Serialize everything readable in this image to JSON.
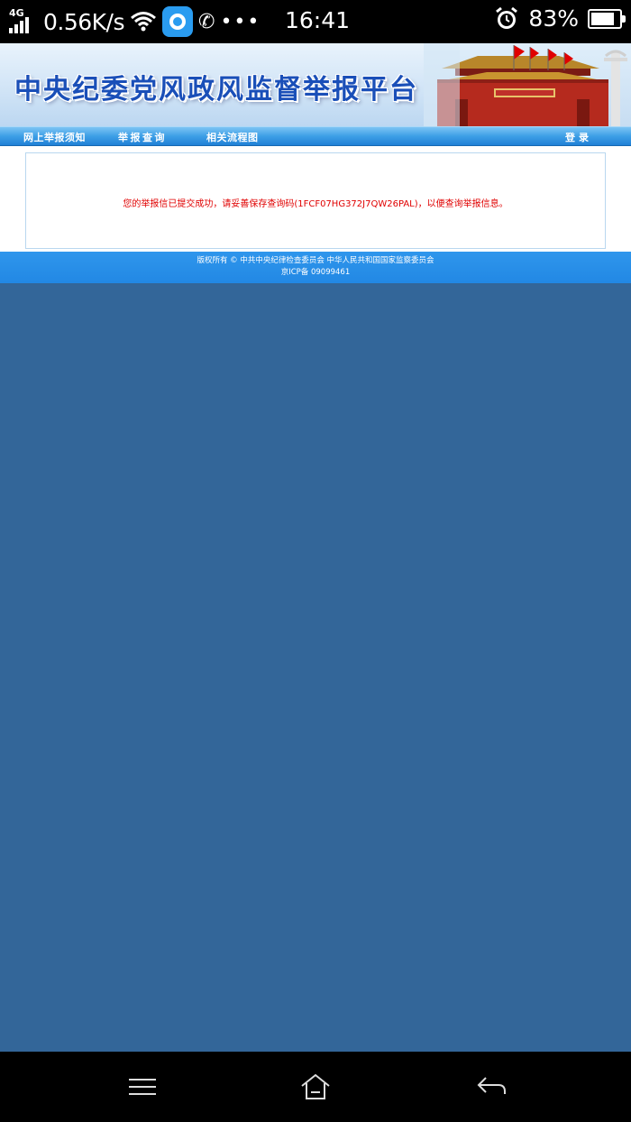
{
  "status_bar": {
    "network_type": "4G",
    "speed": "0.56K/s",
    "time": "16:41",
    "battery_percent": "83%",
    "battery_level": 0.83,
    "icons": [
      "signal-icon",
      "wifi-icon",
      "app-badge-icon",
      "phone-icon",
      "more-icon",
      "alarm-icon",
      "battery-icon"
    ]
  },
  "header": {
    "site_title": "中央纪委党风政风监督举报平台"
  },
  "nav": {
    "items": [
      {
        "label": "网上举报须知"
      },
      {
        "label": "举报查询"
      },
      {
        "label": "相关流程图"
      },
      {
        "label": "登录"
      }
    ]
  },
  "main": {
    "message": "您的举报信已提交成功，请妥善保存查询码(1FCF07HG372J7QW26PAL)，以便查询举报信息。"
  },
  "footer": {
    "copyright": "版权所有 © 中共中央纪律检查委员会 中华人民共和国国家监察委员会",
    "icp": "京ICP备 09099461"
  },
  "colors": {
    "page_background": "#336699",
    "nav_blue": "#2f96ec",
    "title_blue": "#1a4fb8",
    "message_red": "#e00000"
  },
  "android_nav": {
    "icons": [
      "menu-icon",
      "home-icon",
      "back-icon"
    ]
  }
}
